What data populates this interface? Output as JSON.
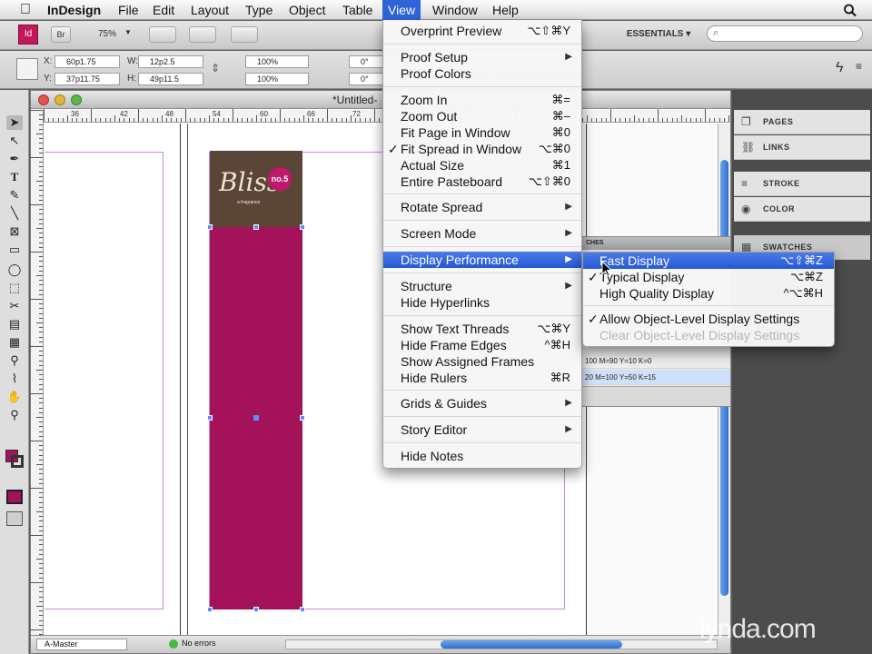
{
  "menubar": {
    "apple": "",
    "app": "InDesign",
    "items": [
      "File",
      "Edit",
      "Layout",
      "Type",
      "Object",
      "Table",
      "View",
      "Window",
      "Help"
    ],
    "search_icon": "search-icon"
  },
  "appbar": {
    "logo": "Id",
    "bridge": "Br",
    "zoom": "75%",
    "workspace": "ESSENTIALS",
    "search_placeholder": ""
  },
  "control": {
    "x_label": "X:",
    "x_value": "60p1.75",
    "y_label": "Y:",
    "y_value": "37p11.75",
    "w_label": "W:",
    "w_value": "12p2.5",
    "h_label": "H:",
    "h_value": "49p11.5",
    "scale_x": "100%",
    "scale_y": "100%",
    "rotate": "0°",
    "shear": "0°"
  },
  "document": {
    "title": "*Untitled-",
    "ruler_labels": [
      "36",
      "42",
      "48",
      "54",
      "60",
      "66",
      "72",
      "78"
    ],
    "page_label": "A-Master",
    "preflight": "No errors"
  },
  "artwork": {
    "brand": "Bliss",
    "badge": "no.5",
    "tagline": "a fragrance",
    "brown": "#5a4536",
    "magenta": "#a4125a"
  },
  "panels": {
    "items": [
      {
        "label": "PAGES",
        "icon": "pages-icon"
      },
      {
        "label": "LINKS",
        "icon": "links-icon"
      },
      {
        "label": "STROKE",
        "icon": "stroke-icon"
      },
      {
        "label": "COLOR",
        "icon": "color-icon"
      },
      {
        "label": "SWATCHES",
        "icon": "swatches-icon"
      }
    ]
  },
  "swatches": {
    "tab": "CHES",
    "rows": [
      "100 M=90 Y=10 K=0",
      "20 M=100 Y=50 K=15"
    ]
  },
  "viewmenu": {
    "items": [
      {
        "label": "Overprint Preview",
        "shortcut": "⌥⇧⌘Y"
      },
      {
        "label": "Proof Setup",
        "submenu": true
      },
      {
        "label": "Proof Colors"
      },
      {
        "label": "Zoom In",
        "shortcut": "⌘="
      },
      {
        "label": "Zoom Out",
        "shortcut": "⌘–"
      },
      {
        "label": "Fit Page in Window",
        "shortcut": "⌘0"
      },
      {
        "label": "Fit Spread in Window",
        "shortcut": "⌥⌘0",
        "checked": true
      },
      {
        "label": "Actual Size",
        "shortcut": "⌘1"
      },
      {
        "label": "Entire Pasteboard",
        "shortcut": "⌥⇧⌘0"
      },
      {
        "label": "Rotate Spread",
        "submenu": true
      },
      {
        "label": "Screen Mode",
        "submenu": true
      },
      {
        "label": "Display Performance",
        "submenu": true,
        "highlighted": true
      },
      {
        "label": "Structure",
        "submenu": true
      },
      {
        "label": "Hide Hyperlinks"
      },
      {
        "label": "Show Text Threads",
        "shortcut": "⌥⌘Y"
      },
      {
        "label": "Hide Frame Edges",
        "shortcut": "^⌘H"
      },
      {
        "label": "Show Assigned Frames"
      },
      {
        "label": "Hide Rulers",
        "shortcut": "⌘R"
      },
      {
        "label": "Grids & Guides",
        "submenu": true
      },
      {
        "label": "Story Editor",
        "submenu": true
      },
      {
        "label": "Hide Notes"
      }
    ],
    "arrow": "▶",
    "check": "✓"
  },
  "submenu": {
    "items": [
      {
        "label": "Fast Display",
        "shortcut": "⌥⇧⌘Z",
        "highlighted": true
      },
      {
        "label": "Typical Display",
        "shortcut": "⌥⌘Z",
        "checked": true
      },
      {
        "label": "High Quality Display",
        "shortcut": "^⌥⌘H"
      },
      {
        "label": "Allow Object-Level Display Settings",
        "checked": true
      },
      {
        "label": "Clear Object-Level Display Settings",
        "disabled": true
      }
    ]
  },
  "watermark": "lynda.com"
}
